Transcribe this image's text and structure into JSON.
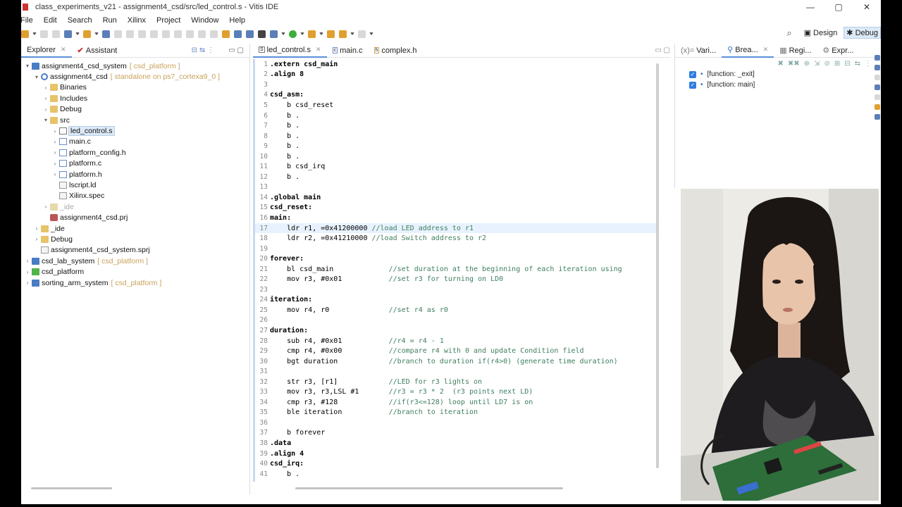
{
  "window": {
    "title": "class_experiments_v21 - assignment4_csd/src/led_control.s - Vitis IDE"
  },
  "menu": [
    "File",
    "Edit",
    "Search",
    "Run",
    "Xilinx",
    "Project",
    "Window",
    "Help"
  ],
  "perspectives": [
    {
      "label": "Design",
      "active": false
    },
    {
      "label": "Debug",
      "active": true
    }
  ],
  "left_tabs": [
    {
      "label": "Explorer",
      "active": true
    },
    {
      "label": "Assistant",
      "active": false
    }
  ],
  "tree": [
    {
      "indent": 0,
      "tw": "▾",
      "icon": "proj",
      "label": "assignment4_csd_system",
      "sub": "[ csd_platform ]"
    },
    {
      "indent": 1,
      "tw": "▾",
      "icon": "gear",
      "label": "assignment4_csd",
      "sub": "[ standalone on ps7_cortexa9_0 ]"
    },
    {
      "indent": 2,
      "tw": "›",
      "icon": "fold",
      "label": "Binaries",
      "sub": ""
    },
    {
      "indent": 2,
      "tw": "›",
      "icon": "fold",
      "label": "Includes",
      "sub": ""
    },
    {
      "indent": 2,
      "tw": "›",
      "icon": "fold",
      "label": "Debug",
      "sub": ""
    },
    {
      "indent": 2,
      "tw": "▾",
      "icon": "fold",
      "label": "src",
      "sub": ""
    },
    {
      "indent": 3,
      "tw": "›",
      "icon": "fileS",
      "label": "led_control.s",
      "sub": "",
      "sel": true
    },
    {
      "indent": 3,
      "tw": "›",
      "icon": "fileC",
      "label": "main.c",
      "sub": ""
    },
    {
      "indent": 3,
      "tw": "›",
      "icon": "fileC",
      "label": "platform_config.h",
      "sub": ""
    },
    {
      "indent": 3,
      "tw": "›",
      "icon": "fileC",
      "label": "platform.c",
      "sub": ""
    },
    {
      "indent": 3,
      "tw": "›",
      "icon": "fileC",
      "label": "platform.h",
      "sub": ""
    },
    {
      "indent": 3,
      "tw": "",
      "icon": "ld",
      "label": "lscript.ld",
      "sub": ""
    },
    {
      "indent": 3,
      "tw": "",
      "icon": "ld",
      "label": "Xilinx.spec",
      "sub": ""
    },
    {
      "indent": 2,
      "tw": "›",
      "icon": "fdis",
      "label": "_ide",
      "sub": "",
      "dim": true
    },
    {
      "indent": 2,
      "tw": "",
      "icon": "spec",
      "label": "assignment4_csd.prj",
      "sub": ""
    },
    {
      "indent": 1,
      "tw": "›",
      "icon": "fold",
      "label": "_ide",
      "sub": ""
    },
    {
      "indent": 1,
      "tw": "›",
      "icon": "fold",
      "label": "Debug",
      "sub": ""
    },
    {
      "indent": 1,
      "tw": "",
      "icon": "ld",
      "label": "assignment4_csd_system.sprj",
      "sub": ""
    },
    {
      "indent": 0,
      "tw": "›",
      "icon": "proj",
      "label": "csd_lab_system",
      "sub": "[ csd_platform ]"
    },
    {
      "indent": 0,
      "tw": "›",
      "icon": "green",
      "label": "csd_platform",
      "sub": ""
    },
    {
      "indent": 0,
      "tw": "›",
      "icon": "proj",
      "label": "sorting_arm_system",
      "sub": "[ csd_platform ]"
    }
  ],
  "editor_tabs": [
    {
      "label": "led_control.s",
      "active": true
    },
    {
      "label": "main.c",
      "active": false
    },
    {
      "label": "complex.h",
      "active": false
    }
  ],
  "code": [
    {
      "n": "1",
      "t": ".extern csd_main",
      "k": "dir"
    },
    {
      "n": "2",
      "t": ".align 8",
      "k": "dir"
    },
    {
      "n": "3",
      "t": "",
      "k": ""
    },
    {
      "n": "4",
      "t": "csd_asm:",
      "k": "lab"
    },
    {
      "n": "5",
      "t": "    b csd_reset",
      "k": ""
    },
    {
      "n": "6",
      "t": "    b .",
      "k": ""
    },
    {
      "n": "7",
      "t": "    b .",
      "k": ""
    },
    {
      "n": "8",
      "t": "    b .",
      "k": ""
    },
    {
      "n": "9",
      "t": "    b .",
      "k": ""
    },
    {
      "n": "10",
      "t": "    b .",
      "k": ""
    },
    {
      "n": "11",
      "t": "    b csd_irq",
      "k": ""
    },
    {
      "n": "12",
      "t": "    b .",
      "k": ""
    },
    {
      "n": "13",
      "t": "",
      "k": ""
    },
    {
      "n": "14",
      "t": ".global main",
      "k": "dir"
    },
    {
      "n": "15",
      "t": "csd_reset:",
      "k": "lab"
    },
    {
      "n": "16",
      "t": "main:",
      "k": "lab"
    },
    {
      "n": "17",
      "t": "    ldr r1, =0x41200000 ",
      "c": "//load LED address to r1",
      "k": "",
      "hl": true
    },
    {
      "n": "18",
      "t": "    ldr r2, =0x41210000 ",
      "c": "//load Switch address to r2",
      "k": ""
    },
    {
      "n": "19",
      "t": "",
      "k": ""
    },
    {
      "n": "20",
      "t": "forever:",
      "k": "lab"
    },
    {
      "n": "21",
      "t": "    bl csd_main             ",
      "c": "//set duration at the beginning of each iteration using",
      "k": ""
    },
    {
      "n": "22",
      "t": "    mov r3, #0x01           ",
      "c": "//set r3 for turning on LD0",
      "k": ""
    },
    {
      "n": "23",
      "t": "",
      "k": ""
    },
    {
      "n": "24",
      "t": "iteration:",
      "k": "lab"
    },
    {
      "n": "25",
      "t": "    mov r4, r0              ",
      "c": "//set r4 as r0",
      "k": ""
    },
    {
      "n": "26",
      "t": "",
      "k": ""
    },
    {
      "n": "27",
      "t": "duration:",
      "k": "lab"
    },
    {
      "n": "28",
      "t": "    sub r4, #0x01           ",
      "c": "//r4 = r4 - 1",
      "k": ""
    },
    {
      "n": "29",
      "t": "    cmp r4, #0x00           ",
      "c": "//compare r4 with 0 and update Condition field",
      "k": ""
    },
    {
      "n": "30",
      "t": "    bgt duration            ",
      "c": "//branch to duration if(r4>0) (generate time duration)",
      "k": ""
    },
    {
      "n": "31",
      "t": "",
      "k": ""
    },
    {
      "n": "32",
      "t": "    str r3, [r1]            ",
      "c": "//LED for r3 lights on",
      "k": ""
    },
    {
      "n": "33",
      "t": "    mov r3, r3,LSL #1       ",
      "c": "//r3 = r3 * 2  (r3 points next LD)",
      "k": ""
    },
    {
      "n": "34",
      "t": "    cmp r3, #128            ",
      "c": "//if(r3<=128) loop until LD7 is on",
      "k": ""
    },
    {
      "n": "35",
      "t": "    ble iteration           ",
      "c": "//branch to iteration",
      "k": ""
    },
    {
      "n": "36",
      "t": "",
      "k": ""
    },
    {
      "n": "37",
      "t": "    b forever",
      "k": ""
    },
    {
      "n": "38",
      "t": ".data",
      "k": "dir"
    },
    {
      "n": "39",
      "t": ".align 4",
      "k": "dir"
    },
    {
      "n": "40",
      "t": "csd_irq:",
      "k": "lab"
    },
    {
      "n": "41",
      "t": "    b .",
      "k": ""
    }
  ],
  "right_tabs": [
    {
      "label": "Vari..."
    },
    {
      "label": "Brea...",
      "active": true
    },
    {
      "label": "Regi..."
    },
    {
      "label": "Expr..."
    }
  ],
  "breakpoints": [
    "[function: _exit]",
    "[function: main]"
  ]
}
